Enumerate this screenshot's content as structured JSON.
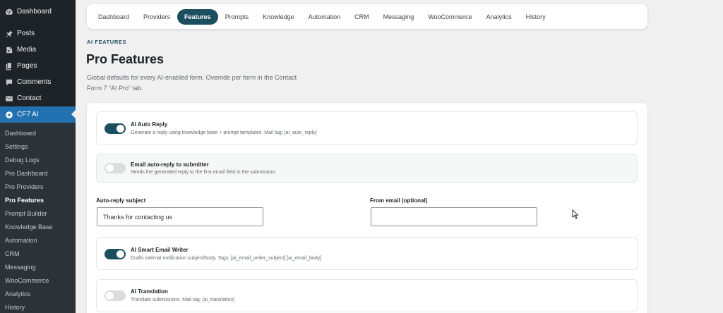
{
  "sidebar": {
    "top_items": [
      {
        "label": "Dashboard",
        "icon": "dashboard-icon"
      },
      {
        "label": "Posts",
        "icon": "pin-icon"
      },
      {
        "label": "Media",
        "icon": "media-icon"
      },
      {
        "label": "Pages",
        "icon": "pages-icon"
      },
      {
        "label": "Comments",
        "icon": "comment-icon"
      },
      {
        "label": "Contact",
        "icon": "mail-icon"
      },
      {
        "label": "CF7 AI",
        "icon": "cf7-icon"
      }
    ],
    "sub_items": [
      "Dashboard",
      "Settings",
      "Debug Logs",
      "Pro Dashboard",
      "Pro Providers",
      "Pro Features",
      "Prompt Builder",
      "Knowledge Base",
      "Automation",
      "CRM",
      "Messaging",
      "WooCommerce",
      "Analytics",
      "History"
    ]
  },
  "tabs": [
    "Dashboard",
    "Providers",
    "Features",
    "Prompts",
    "Knowledge",
    "Automation",
    "CRM",
    "Messaging",
    "WooCommerce",
    "Analytics",
    "History"
  ],
  "header": {
    "kicker": "AI FEATURES",
    "title": "Pro Features",
    "description": "Global defaults for every AI-enabled form. Override per form in the Contact Form 7 “AI Pro” tab."
  },
  "features": {
    "auto_reply": {
      "label": "AI Auto Reply",
      "help": "Generate a reply using knowledge base + prompt templates. Mail tag: [ai_auto_reply]",
      "enabled": true
    },
    "email_auto_reply": {
      "label": "Email auto-reply to submitter",
      "help": "Sends the generated reply to the first email field in the submission.",
      "enabled": false
    },
    "subject": {
      "label": "Auto-reply subject",
      "value": "Thanks for contacting us"
    },
    "from_email": {
      "label": "From email (optional)",
      "value": ""
    },
    "smart_writer": {
      "label": "AI Smart Email Writer",
      "help": "Crafts internal notification subject/body. Tags: [ai_email_writer_subject] [ai_email_body]",
      "enabled": true
    },
    "translation": {
      "label": "AI Translation",
      "help": "Translate submissions. Mail tag: [ai_translation]",
      "enabled": false
    }
  },
  "colors": {
    "accent": "#1b4f5f",
    "wp_admin_blue": "#2271b1",
    "sidebar": "#1d2327"
  }
}
